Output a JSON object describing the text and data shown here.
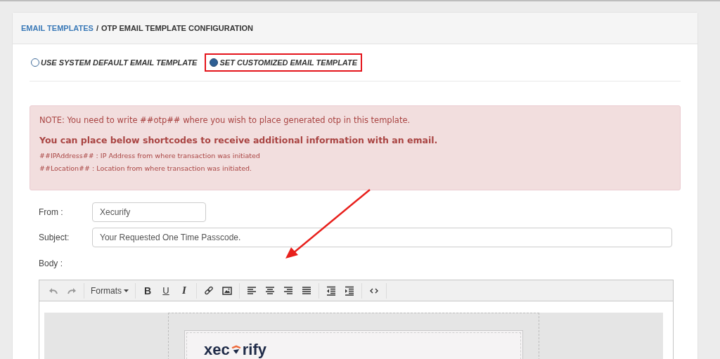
{
  "breadcrumb": {
    "link": "EMAIL TEMPLATES",
    "separator": "/",
    "current": "OTP EMAIL TEMPLATE CONFIGURATION"
  },
  "template_options": [
    {
      "label": "USE SYSTEM DEFAULT EMAIL TEMPLATE",
      "selected": false,
      "highlighted": false
    },
    {
      "label": "SET CUSTOMIZED EMAIL TEMPLATE",
      "selected": true,
      "highlighted": true
    }
  ],
  "alert": {
    "note": "NOTE: You need to write ##otp## where you wish to place generated otp in this template.",
    "heading": "You can place below shortcodes to receive additional information with an email.",
    "shortcodes": [
      "##IPAddress## : IP Address from where transaction was initiated",
      "##Location## : Location from where transaction was initiated."
    ]
  },
  "fields": [
    {
      "label": "From :",
      "value": "Xecurify",
      "kind": "short"
    },
    {
      "label": "Subject:",
      "value": "Your Requested One Time Passcode.",
      "kind": "wide"
    }
  ],
  "body_label": "Body :",
  "toolbar": [
    [
      {
        "kind": "undo",
        "disabled": true
      },
      {
        "kind": "redo",
        "disabled": true
      }
    ],
    [
      {
        "kind": "dropdown",
        "label": "Formats",
        "disabled": false
      }
    ],
    [
      {
        "kind": "bold",
        "label": "B",
        "disabled": false
      },
      {
        "kind": "underline",
        "label": "U",
        "disabled": false
      },
      {
        "kind": "italic",
        "label": "I",
        "disabled": false
      }
    ],
    [
      {
        "kind": "link",
        "disabled": false
      },
      {
        "kind": "image",
        "disabled": false
      }
    ],
    [
      {
        "kind": "align-left",
        "disabled": false
      },
      {
        "kind": "align-center",
        "disabled": false
      },
      {
        "kind": "align-right",
        "disabled": false
      },
      {
        "kind": "justify",
        "disabled": false
      }
    ],
    [
      {
        "kind": "outdent",
        "disabled": false
      },
      {
        "kind": "indent",
        "disabled": false
      }
    ],
    [
      {
        "kind": "code",
        "disabled": false
      }
    ]
  ],
  "email_logo": {
    "before": "xec",
    "after": "rify"
  }
}
